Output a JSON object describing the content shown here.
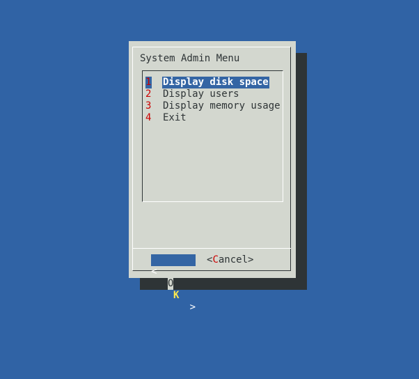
{
  "dialog": {
    "title": "System Admin Menu"
  },
  "menu": {
    "items": [
      {
        "tag": "1",
        "label": "Display disk space",
        "selected": true
      },
      {
        "tag": "2",
        "label": "Display users",
        "selected": false
      },
      {
        "tag": "3",
        "label": "Display memory usage",
        "selected": false
      },
      {
        "tag": "4",
        "label": "Exit",
        "selected": false
      }
    ]
  },
  "buttons": {
    "ok": {
      "bracket_left": "<",
      "text_first": "O",
      "text_hotkey": "K",
      "bracket_right": ">"
    },
    "cancel": {
      "bracket_left": "<",
      "hotkey": "C",
      "rest": "ancel",
      "bracket_right": ">"
    }
  },
  "colors": {
    "background": "#3063a5",
    "dialog": "#d3d7cf",
    "shadow": "#2e3436",
    "selection": "#3465a4",
    "tag": "#cc0000",
    "hotkey_active": "#fce94f"
  }
}
